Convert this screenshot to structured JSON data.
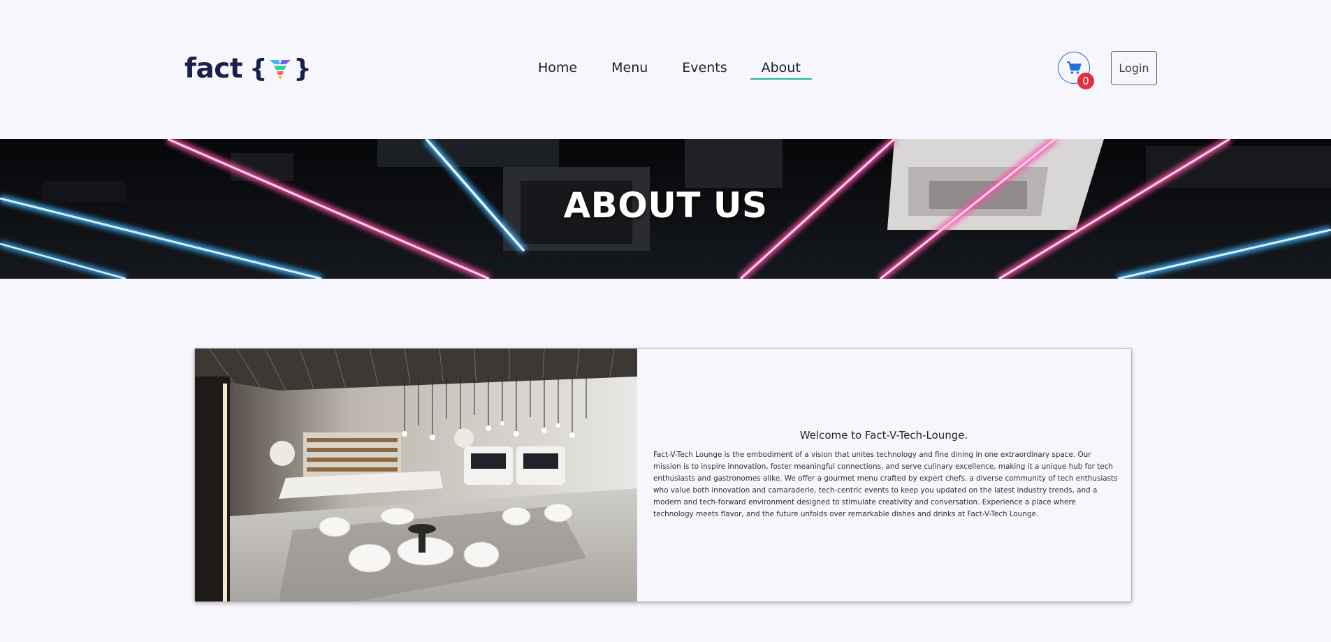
{
  "header": {
    "logo_text": "fact",
    "logo_brace_open": "{",
    "logo_brace_close": "}",
    "nav": [
      {
        "label": "Home"
      },
      {
        "label": "Menu"
      },
      {
        "label": "Events"
      },
      {
        "label": "About",
        "active": true
      }
    ],
    "cart_count": "0",
    "login_label": "Login"
  },
  "hero": {
    "title": "ABOUT US"
  },
  "about": {
    "title": "Welcome to Fact-V-Tech-Lounge.",
    "body": "Fact-V-Tech Lounge is the embodiment of a vision that unites technology and fine dining in one extraordinary space. Our mission is to inspire innovation, foster meaningful connections, and serve culinary excellence, making it a unique hub for tech enthusiasts and gastronomes alike. We offer a gourmet menu crafted by expert chefs, a diverse community of tech enthusiasts who value both innovation and camaraderie, tech-centric events to keep you updated on the latest industry trends, and a modern and tech-forward environment designed to stimulate creativity and conversation. Experience a place where technology meets flavor, and the future unfolds over remarkable dishes and drinks at Fact-V-Tech Lounge."
  },
  "colors": {
    "accent_underline": "#1fb89a",
    "cart_blue": "#1f6fe0",
    "badge_red": "#e2303e",
    "logo_navy": "#1b1f4d",
    "neon_pink": "#ff4fa8",
    "neon_blue": "#3fb6ff"
  },
  "icons": {
    "cart": "shopping-cart-icon",
    "logo_mark": "v-logo-icon"
  }
}
